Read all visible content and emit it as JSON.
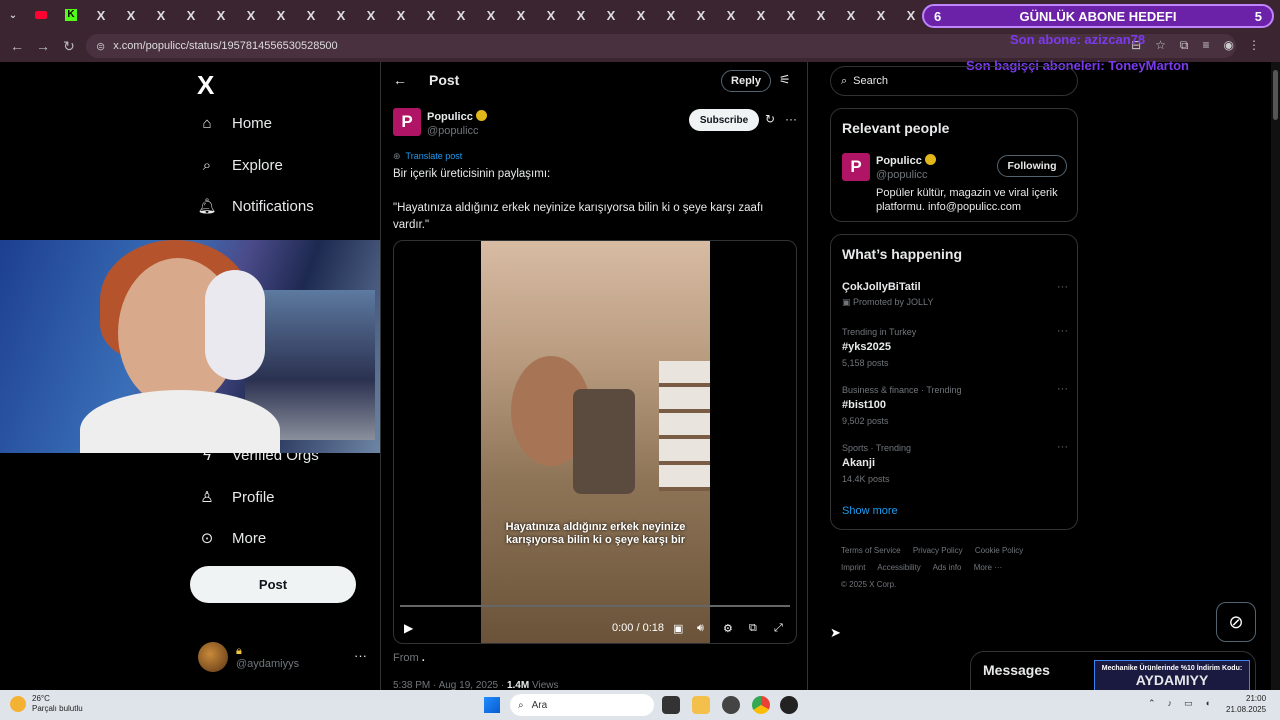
{
  "browser": {
    "url": "x.com/populicc/status/1957814556530528500",
    "tab_labels": [
      "K",
      "X"
    ]
  },
  "overlay": {
    "goal_left": "6",
    "goal_title": "GÜNLÜK ABONE HEDEFI",
    "goal_right": "5",
    "last_sub": "Son abone: azizcan78",
    "last_donor": "Son bagişçi aboneleri: ToneyMarton"
  },
  "nav": {
    "logo": "X",
    "items": [
      {
        "label": "Home",
        "icon": "home-icon"
      },
      {
        "label": "Explore",
        "icon": "search-icon"
      },
      {
        "label": "Notifications",
        "icon": "bell-icon"
      },
      {
        "label": "Verified Orgs",
        "icon": "lightning-icon"
      },
      {
        "label": "Profile",
        "icon": "person-icon"
      },
      {
        "label": "More",
        "icon": "more-circle-icon"
      }
    ],
    "post_label": "Post",
    "account_handle": "@aydamiyys"
  },
  "post": {
    "header_title": "Post",
    "reply_label": "Reply",
    "author_name": "Populicc",
    "author_handle": "@populicc",
    "subscribe_label": "Subscribe",
    "translate_label": "Translate post",
    "text_line1": "Bir içerik üreticisinin paylaşımı:",
    "text_line2": "\"Hayatınıza aldığınız erkek neyinize karışıyorsa bilin ki o şeye karşı zaafı vardır.\"",
    "video_caption": "Hayatınıza aldığınız erkek neyinize karışıyorsa bilin ki o şeye karşı bir",
    "video_time": "0:00 / 0:18",
    "from_label": "From",
    "meta_time": "5:38 PM · Aug 19, 2025 ·",
    "meta_views_count": "1.4M",
    "meta_views_label": "Views"
  },
  "sidebar": {
    "search_placeholder": "Search",
    "relevant_title": "Relevant people",
    "relevant_name": "Populicc",
    "relevant_handle": "@populicc",
    "following_label": "Following",
    "relevant_bio": "Popüler kültür, magazin ve viral içerik platformu. info@populicc.com",
    "happening_title": "What’s happening",
    "trends": [
      {
        "category": "",
        "name": "ÇokJollyBiTatil",
        "count": "Promoted by JOLLY"
      },
      {
        "category": "Trending in Turkey",
        "name": "#yks2025",
        "count": "5,158 posts"
      },
      {
        "category": "Business & finance · Trending",
        "name": "#bist100",
        "count": "9,502 posts"
      },
      {
        "category": "Sports · Trending",
        "name": "Akanji",
        "count": "14.4K posts"
      }
    ],
    "show_more": "Show more",
    "footer_links": [
      "Terms of Service",
      "Privacy Policy",
      "Cookie Policy",
      "Imprint",
      "Accessibility",
      "Ads info",
      "More ···"
    ],
    "copyright": "© 2025 X Corp.",
    "messages_label": "Messages"
  },
  "promo": {
    "line1": "Mechanike Ürünlerinde %10 İndirim Kodu:",
    "line2": "AYDAMIYY"
  },
  "taskbar": {
    "temp": "26°C",
    "weather": "Parçalı bulutlu",
    "search_placeholder": "Ara",
    "time": "21:00",
    "date": "21.08.2025"
  },
  "colors": {
    "accent": "#1d9bf0",
    "brand_populicc": "#b01565",
    "verified_gold": "#e2b719",
    "overlay_purple": "#6b21a8"
  }
}
